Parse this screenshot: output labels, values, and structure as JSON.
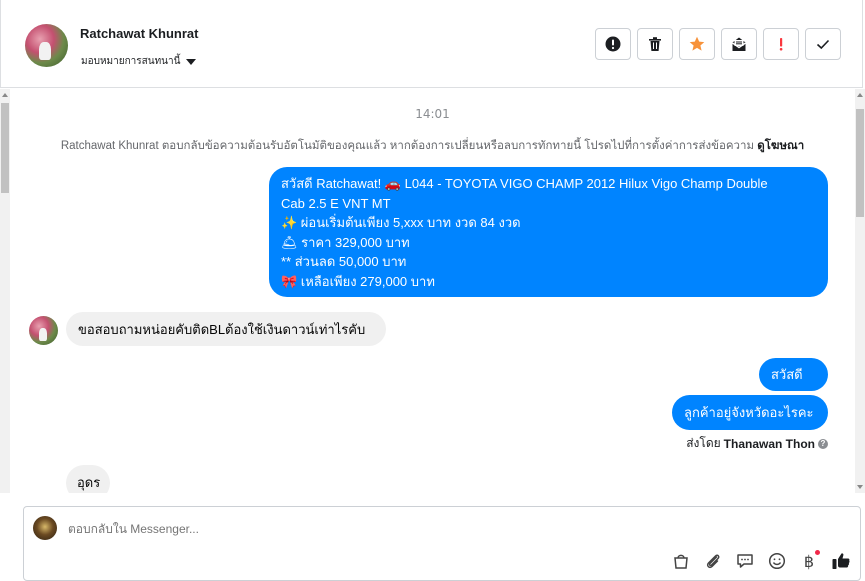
{
  "header": {
    "contact_name": "Ratchawat Khunrat",
    "assign_label": "มอบหมายการสนทนานี้",
    "actions": [
      {
        "name": "report-spam-button",
        "icon": "exclamation-circle-icon"
      },
      {
        "name": "delete-button",
        "icon": "trash-icon"
      },
      {
        "name": "star-button",
        "icon": "star-icon",
        "color": "#f7923a"
      },
      {
        "name": "mark-unread-button",
        "icon": "envelope-icon"
      },
      {
        "name": "mark-important-button",
        "icon": "exclamation-icon",
        "color": "#fa383e"
      },
      {
        "name": "mark-done-button",
        "icon": "checkmark-icon"
      }
    ]
  },
  "conversation": {
    "timestamp": "14:01",
    "notice": "Ratchawat Khunrat ตอบกลับข้อความต้อนรับอัตโนมัติของคุณแล้ว หากต้องการเปลี่ยนหรือลบการทักทายนี้ โปรดไปที่การตั้งค่าการส่งข้อความ",
    "notice_link": "ดูโฆษณา",
    "messages": {
      "out_promo": {
        "line1": "สวัสดี Ratchawat! 🚗 L044 - TOYOTA VIGO CHAMP 2012 Hilux Vigo Champ Double",
        "line2": "Cab 2.5 E VNT MT",
        "line3": "✨ ผ่อนเริ่มต้นเพียง 5,xxx บาท งวด 84 งวด",
        "line4": "🛎 ราคา 329,000 บาท",
        "line5": "** ส่วนลด 50,000 บาท",
        "line6": "🎀 เหลือเพียง 279,000 บาท"
      },
      "in_question": "ขอสอบถามหน่อยคับติดBLต้องใช้เงินดาวน์เท่าไรคับ",
      "out_greet": "สวัสดีคะ",
      "out_province": "ลูกค้าอยู่จังหวัดอะไรคะ",
      "sent_by_label": "ส่งโดย",
      "sent_by_name": "Thanawan Thon",
      "in_reply": "อุดร"
    }
  },
  "composer": {
    "placeholder": "ตอบกลับใน Messenger...",
    "tools": [
      "shopping-bag-icon",
      "paperclip-icon",
      "chat-bubble-icon",
      "smiley-icon",
      "baht-icon",
      "thumbs-up-icon"
    ],
    "baht_symbol": "฿"
  },
  "colors": {
    "accent": "#0084ff",
    "incoming_bubble": "#f0f0f0"
  }
}
